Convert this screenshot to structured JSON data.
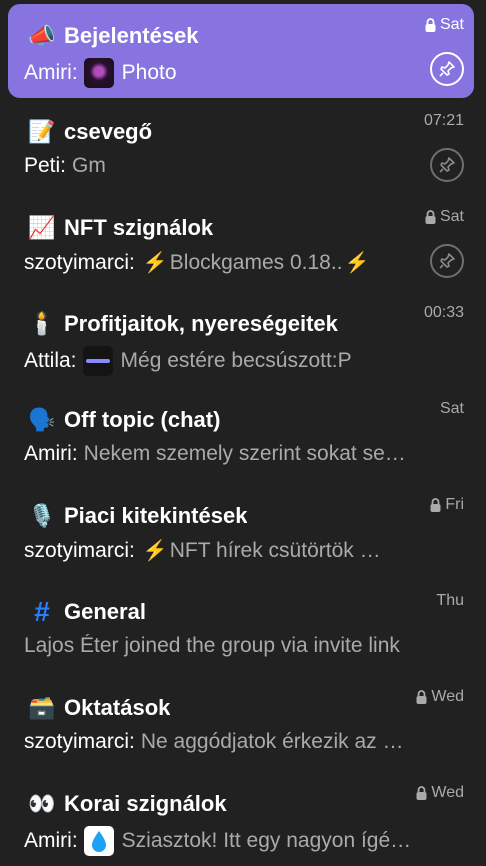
{
  "chats": [
    {
      "title": "Bejelentések",
      "emoji": "📣",
      "time": "Sat",
      "locked": true,
      "sender": "Amiri:",
      "preview": "Photo",
      "pinned": true,
      "active": true,
      "thumb": "dark"
    },
    {
      "title": "csevegő",
      "emoji": "📝",
      "time": "07:21",
      "locked": false,
      "sender": "Peti:",
      "preview": "Gm",
      "pinned": true,
      "active": false
    },
    {
      "title": "NFT szignálok",
      "emoji": "📈",
      "time": "Sat",
      "locked": true,
      "sender": "szotyimarci:",
      "preview": "Blockgames 0.18..",
      "pinned": true,
      "active": false
    },
    {
      "title": "Profitjaitok, nyereségeitek",
      "emoji": "🕯️",
      "time": "00:33",
      "locked": false,
      "sender": "Attila:",
      "preview": "Még estére becsúszott:P",
      "pinned": false,
      "active": false,
      "thumb": "bar"
    },
    {
      "title": "Off topic (chat)",
      "emoji": "🗣️",
      "time": "Sat",
      "locked": false,
      "sender": "Amiri:",
      "preview": "Nekem szemely szerint sokat se…",
      "pinned": false,
      "active": false
    },
    {
      "title": "Piaci kitekintések",
      "emoji": "🎙️",
      "time": "Fri",
      "locked": true,
      "sender": "szotyimarci:",
      "preview": "NFT hírek  csütörtök …",
      "pinned": false,
      "active": false
    },
    {
      "title": "General",
      "emoji": "#",
      "time": "Thu",
      "locked": false,
      "sender": "",
      "preview": "Lajos Éter joined the group via invite link",
      "pinned": false,
      "active": false
    },
    {
      "title": "Oktatások",
      "emoji": "🗃️",
      "time": "Wed",
      "locked": true,
      "sender": "szotyimarci:",
      "preview": "Ne aggódjatok érkezik az …",
      "pinned": false,
      "active": false
    },
    {
      "title": "Korai szignálok",
      "emoji": "👀",
      "time": "Wed",
      "locked": true,
      "sender": "Amiri:",
      "preview": "Sziasztok! Itt egy nagyon ígé…",
      "pinned": false,
      "active": false,
      "thumb": "drop"
    }
  ],
  "colors": {
    "accent": "#8774e1",
    "background": "#212121",
    "muted": "#aaaaaa"
  }
}
